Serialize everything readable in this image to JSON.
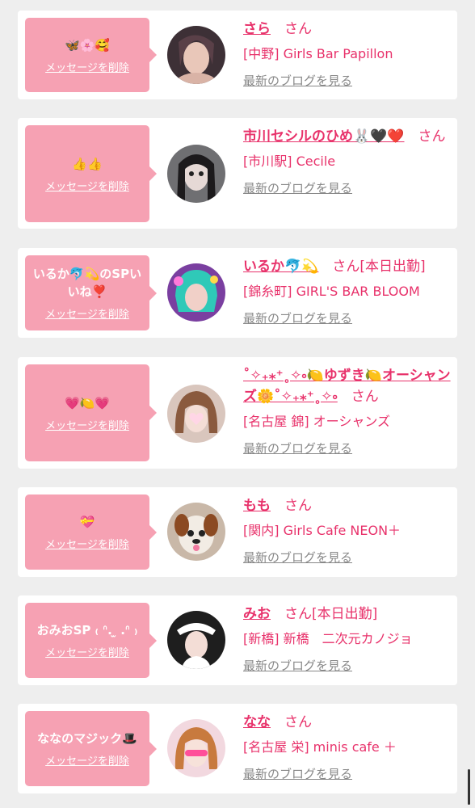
{
  "colors": {
    "accent": "#e8326b",
    "bubble": "#f6a1b3",
    "background": "#eeeeee",
    "link_gray": "#888888"
  },
  "delete_label": "メッセージを削除",
  "blog_label": "最新のブログを見る",
  "san": "さん",
  "cards": [
    {
      "message": "🦋🌸🥰",
      "name": "さら",
      "suffix": "",
      "shop": "[中野] Girls Bar Papillon"
    },
    {
      "message": "👍👍",
      "name": "市川セシルのひめ🐰🖤❤️",
      "suffix": "",
      "shop": "[市川駅] Cecile"
    },
    {
      "message": "いるか🐬💫のSPいいね❣️",
      "name": "いるか🐬💫",
      "suffix": "[本日出勤]",
      "shop": "[錦糸町] GIRL'S BAR BLOOM"
    },
    {
      "message": "💗🍋💗",
      "name": "˚✧₊⁎⁺˳✧༚🍋ゆずき🍋オーシャンズ🌼˚✧₊⁎⁺˳✧༚",
      "suffix": "",
      "shop": "[名古屋 錦] オーシャンズ"
    },
    {
      "message": "💝",
      "name": "もも",
      "suffix": "",
      "shop": "[関内] Girls Cafe NEON＋"
    },
    {
      "message": "おみおSP ₍ ᐢ. ̫ .ᐢ ₎",
      "name": "みお",
      "suffix": "[本日出勤]",
      "shop": "[新橋] 新橋　二次元カノジョ"
    },
    {
      "message": "ななのマジック🎩",
      "name": "なな",
      "suffix": "",
      "shop": "[名古屋 栄] minis cafe ＋"
    }
  ]
}
